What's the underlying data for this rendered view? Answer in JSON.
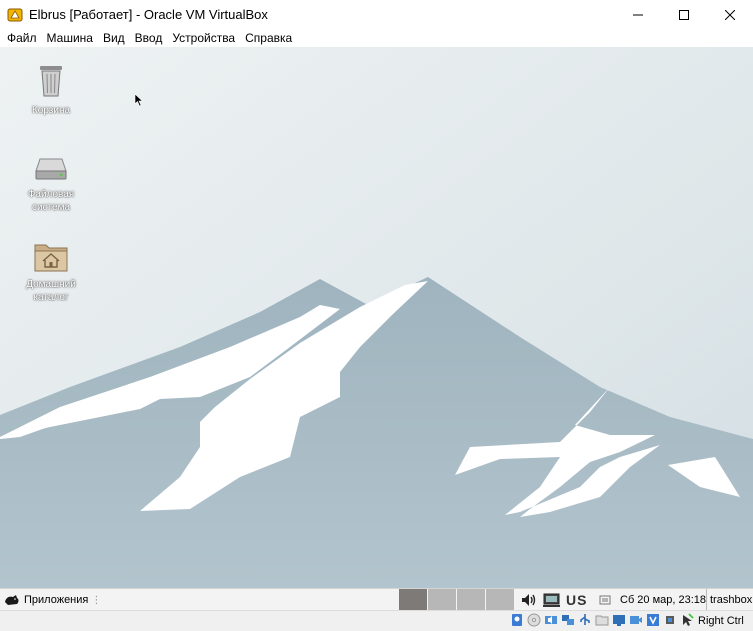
{
  "window": {
    "title": "Elbrus [Работает] - Oracle VM VirtualBox"
  },
  "menu": [
    "Файл",
    "Машина",
    "Вид",
    "Ввод",
    "Устройства",
    "Справка"
  ],
  "desktop_icons": [
    {
      "id": "trash",
      "icon": "trash-icon",
      "label": "Корзина"
    },
    {
      "id": "filesystem",
      "icon": "drive-icon",
      "label": "Файловая система"
    },
    {
      "id": "home",
      "icon": "home-folder-icon",
      "label": "Домашний каталог"
    }
  ],
  "taskbar": {
    "apps_label": "Приложения",
    "workspaces": 4,
    "active_workspace": 1,
    "keyboard_layout": "US",
    "clock": "Сб 20 мар, 23:18",
    "user": "trashbox"
  },
  "statusbar": {
    "host_key": "Right Ctrl"
  },
  "colors": {
    "sky": "#e6ecef",
    "mountain": "#a5b8c3",
    "snow": "#ffffff",
    "workspace_active": "#7d7a77",
    "workspace": "#b7b7b7"
  }
}
